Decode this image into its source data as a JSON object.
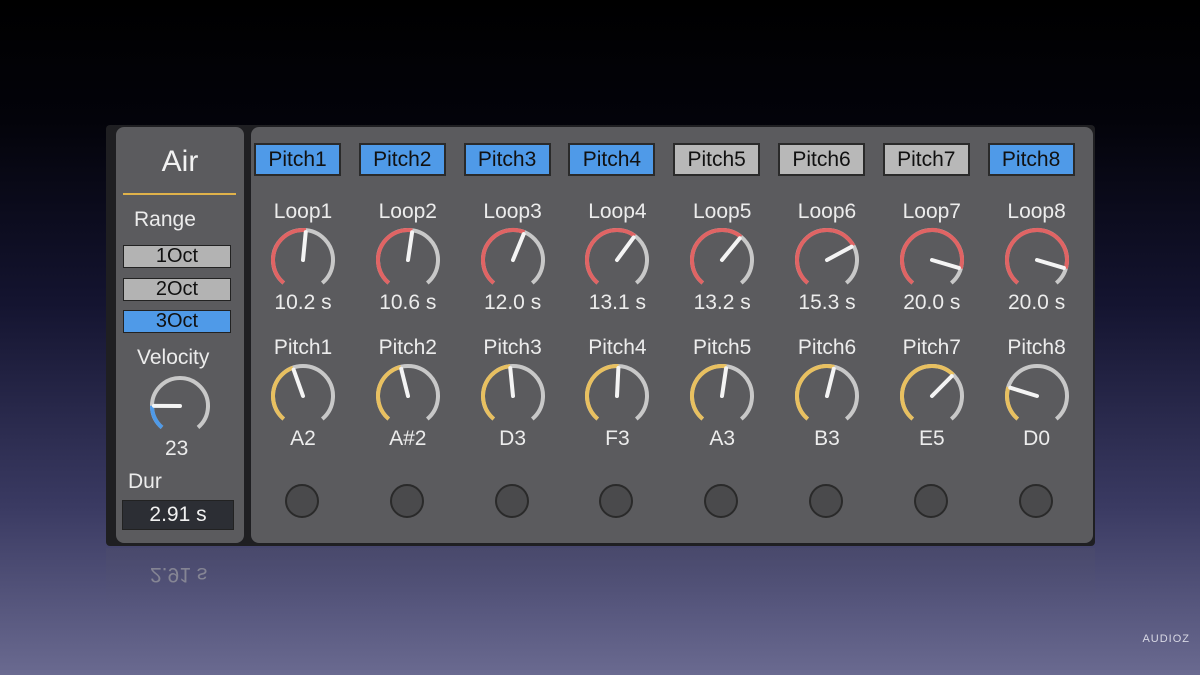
{
  "left": {
    "title": "Air",
    "range_label": "Range",
    "range_options": [
      {
        "label": "1Oct",
        "active": false
      },
      {
        "label": "2Oct",
        "active": false
      },
      {
        "label": "3Oct",
        "active": true
      }
    ],
    "velocity_label": "Velocity",
    "velocity_value": "23",
    "velocity_fraction": 0.18,
    "dur_label": "Dur",
    "dur_value": "2.91 s",
    "reflection_text": "2.91 s"
  },
  "colors": {
    "loop_arc": "#e06464",
    "pitch_arc": "#e8c060",
    "velocity_arc": "#4f9ae8",
    "track": "#c8c8c8",
    "active_button": "#4f9ae8",
    "inactive_button": "#b8b8b8"
  },
  "channels": [
    {
      "button": "Pitch1",
      "on": true,
      "loop_label": "Loop1",
      "loop_value": "10.2 s",
      "loop_fraction": 0.52,
      "pitch_label": "Pitch1",
      "pitch_value": "A2",
      "pitch_fraction": 0.43
    },
    {
      "button": "Pitch2",
      "on": true,
      "loop_label": "Loop2",
      "loop_value": "10.6 s",
      "loop_fraction": 0.53,
      "pitch_label": "Pitch2",
      "pitch_value": "A#2",
      "pitch_fraction": 0.45
    },
    {
      "button": "Pitch3",
      "on": true,
      "loop_label": "Loop3",
      "loop_value": "12.0 s",
      "loop_fraction": 0.58,
      "pitch_label": "Pitch3",
      "pitch_value": "D3",
      "pitch_fraction": 0.48
    },
    {
      "button": "Pitch4",
      "on": true,
      "loop_label": "Loop4",
      "loop_value": "13.1 s",
      "loop_fraction": 0.63,
      "pitch_label": "Pitch4",
      "pitch_value": "F3",
      "pitch_fraction": 0.51
    },
    {
      "button": "Pitch5",
      "on": false,
      "loop_label": "Loop5",
      "loop_value": "13.2 s",
      "loop_fraction": 0.64,
      "pitch_label": "Pitch5",
      "pitch_value": "A3",
      "pitch_fraction": 0.53
    },
    {
      "button": "Pitch6",
      "on": false,
      "loop_label": "Loop6",
      "loop_value": "15.3 s",
      "loop_fraction": 0.72,
      "pitch_label": "Pitch6",
      "pitch_value": "B3",
      "pitch_fraction": 0.55
    },
    {
      "button": "Pitch7",
      "on": false,
      "loop_label": "Loop7",
      "loop_value": "20.0 s",
      "loop_fraction": 0.88,
      "pitch_label": "Pitch7",
      "pitch_value": "E5",
      "pitch_fraction": 0.66
    },
    {
      "button": "Pitch8",
      "on": true,
      "loop_label": "Loop8",
      "loop_value": "20.0 s",
      "loop_fraction": 0.88,
      "pitch_label": "Pitch8",
      "pitch_value": "D0",
      "pitch_fraction": 0.24
    }
  ],
  "watermark": "AUDIOZ"
}
